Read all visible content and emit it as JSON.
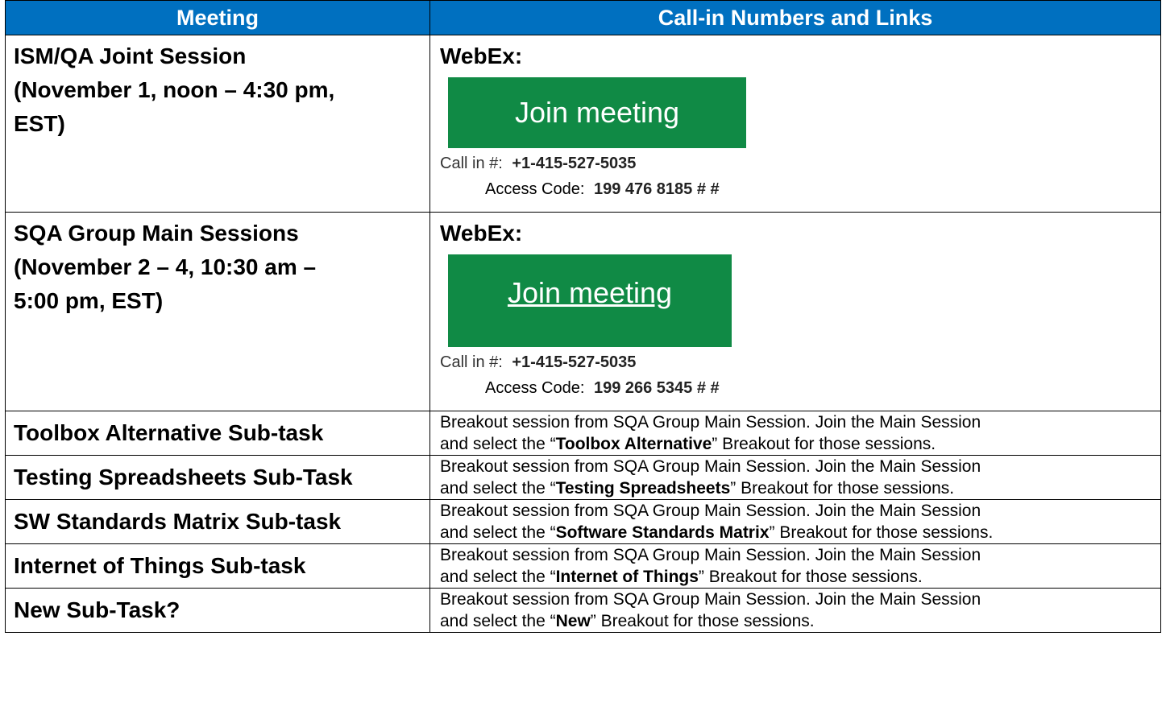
{
  "table": {
    "headers": [
      "Meeting",
      "Call-in Numbers and Links"
    ],
    "sessions": [
      {
        "meeting_lines": [
          "ISM/QA Joint Session",
          "(November 1, noon – 4:30 pm,",
          "EST)"
        ],
        "webex_label": "WebEx:",
        "join_label": "Join meeting",
        "callin_label": "Call in #:",
        "callin_number": "+1-415-527-5035",
        "access_label": "Access Code:",
        "access_code": "199 476 8185 # #"
      },
      {
        "meeting_lines": [
          "SQA Group Main Sessions",
          "(November 2 – 4, 10:30 am –",
          "5:00 pm, EST)"
        ],
        "webex_label": "WebEx:",
        "join_label": "Join meeting",
        "callin_label": "Call in #:",
        "callin_number": "+1-415-527-5035",
        "access_label": "Access Code:",
        "access_code": "199 266 5345 # #"
      }
    ],
    "subtasks": [
      {
        "name": "Toolbox Alternative Sub-task",
        "line1": "Breakout session from SQA Group Main Session.  Join the Main Session",
        "pre": "and select the “",
        "bold": "Toolbox Alternative",
        "post": "” Breakout for those sessions."
      },
      {
        "name": "Testing Spreadsheets Sub-Task",
        "line1": "Breakout session from SQA Group Main Session.  Join the Main Session",
        "pre": "and select the “",
        "bold": "Testing Spreadsheets",
        "post": "” Breakout for those sessions."
      },
      {
        "name": "SW Standards Matrix Sub-task",
        "line1": "Breakout session from SQA Group Main Session.  Join the Main Session",
        "pre": "and select the “",
        "bold": "Software Standards Matrix",
        "post": "” Breakout for those sessions."
      },
      {
        "name": "Internet of Things Sub-task",
        "line1": "Breakout session from SQA Group Main Session.  Join the Main Session",
        "pre": "and select the “",
        "bold": "Internet of Things",
        "post": "” Breakout for those sessions."
      },
      {
        "name": "New Sub-Task?",
        "line1": "Breakout session from SQA Group Main Session.  Join the Main Session",
        "pre": "and select the “",
        "bold": "New",
        "post": "” Breakout for those sessions."
      }
    ]
  },
  "colors": {
    "header_bg": "#0070c0",
    "button_bg": "#108a45"
  }
}
